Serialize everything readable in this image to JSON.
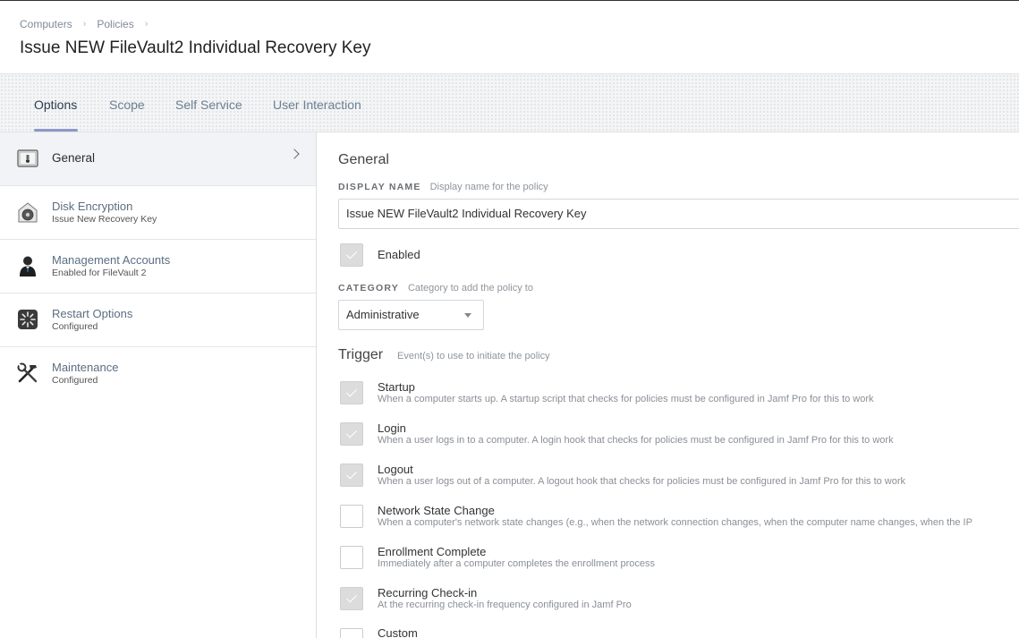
{
  "breadcrumb": {
    "items": [
      "Computers",
      "Policies"
    ]
  },
  "page": {
    "title": "Issue NEW FileVault2 Individual Recovery Key"
  },
  "tabs": [
    {
      "label": "Options",
      "active": true
    },
    {
      "label": "Scope"
    },
    {
      "label": "Self Service"
    },
    {
      "label": "User Interaction"
    }
  ],
  "sidebar": {
    "items": [
      {
        "title": "General",
        "subtitle": "",
        "icon": "general-settings-icon",
        "active": true
      },
      {
        "title": "Disk Encryption",
        "subtitle": "Issue New Recovery Key",
        "icon": "disk-encryption-icon"
      },
      {
        "title": "Management Accounts",
        "subtitle": "Enabled for FileVault 2",
        "icon": "management-account-icon"
      },
      {
        "title": "Restart Options",
        "subtitle": "Configured",
        "icon": "restart-icon"
      },
      {
        "title": "Maintenance",
        "subtitle": "Configured",
        "icon": "maintenance-tools-icon"
      }
    ]
  },
  "general": {
    "title": "General",
    "display_name": {
      "label": "DISPLAY NAME",
      "hint": "Display name for the policy",
      "value": "Issue NEW FileVault2 Individual Recovery Key"
    },
    "enabled": {
      "label": "Enabled",
      "checked": true
    },
    "category": {
      "label": "CATEGORY",
      "hint": "Category to add the policy to",
      "value": "Administrative"
    }
  },
  "trigger": {
    "title": "Trigger",
    "hint": "Event(s) to use to initiate the policy",
    "items": [
      {
        "label": "Startup",
        "desc": "When a computer starts up. A startup script that checks for policies must be configured in Jamf Pro for this to work",
        "checked": true
      },
      {
        "label": "Login",
        "desc": "When a user logs in to a computer. A login hook that checks for policies must be configured in Jamf Pro for this to work",
        "checked": true
      },
      {
        "label": "Logout",
        "desc": "When a user logs out of a computer. A logout hook that checks for policies must be configured in Jamf Pro for this to work",
        "checked": true
      },
      {
        "label": "Network State Change",
        "desc": "When a computer's network state changes (e.g., when the network connection changes, when the computer name changes, when the IP",
        "checked": false
      },
      {
        "label": "Enrollment Complete",
        "desc": "Immediately after a computer completes the enrollment process",
        "checked": false
      },
      {
        "label": "Recurring Check-in",
        "desc": "At the recurring check-in frequency configured in Jamf Pro",
        "checked": true
      },
      {
        "label": "Custom",
        "desc": "",
        "checked": false
      }
    ]
  },
  "colors": {
    "accent": "#8d97c9",
    "tab_text": "#6c7f93",
    "checked_box": "#dcdcdc"
  }
}
